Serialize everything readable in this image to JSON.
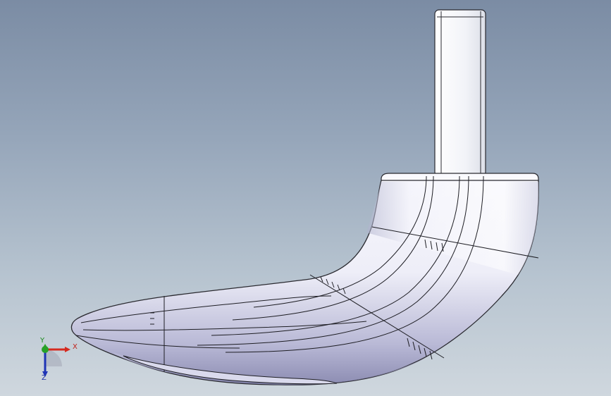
{
  "viewport": {
    "background_top": "#7b8ca4",
    "background_bottom": "#cfd7de",
    "model_name": "golf-club-head-model"
  },
  "triad": {
    "x_label": "X",
    "y_label": "Y",
    "z_label": "Z",
    "x_color": "#c0201a",
    "y_color": "#1b8a1b",
    "z_color": "#1c2fa8"
  }
}
